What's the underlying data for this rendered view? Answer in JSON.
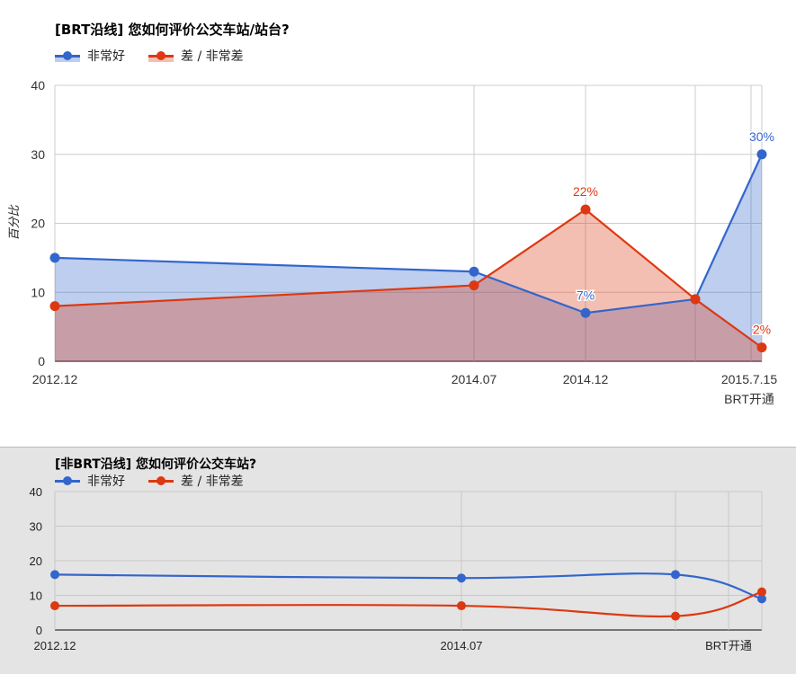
{
  "colors": {
    "good": "#3366cc",
    "bad": "#dc3912"
  },
  "chart_data": [
    {
      "type": "area",
      "title": "[BRT沿线] 您如何评价公交车站/站台?",
      "ylabel": "百分比",
      "ylim": [
        0,
        40
      ],
      "y_ticks": [
        "0",
        "10",
        "20",
        "30",
        "40"
      ],
      "x": [
        "2012-12",
        "2014-07",
        "2014-12",
        "2015-05",
        "2015-07-15"
      ],
      "x_tick_labels": [
        "2012.12",
        "2014.07",
        "2014.12",
        "",
        "2015.7.15"
      ],
      "x_event_label": "BRT开通",
      "grid": true,
      "legend": "top-left",
      "series": [
        {
          "name": "非常好",
          "values": [
            15,
            13,
            7,
            9,
            30
          ],
          "annotations": [
            "",
            "",
            "7%",
            "",
            "30%"
          ]
        },
        {
          "name": "差 / 非常差",
          "values": [
            8,
            11,
            22,
            9,
            2
          ],
          "annotations": [
            "",
            "",
            "22%",
            "",
            "2%"
          ]
        }
      ]
    },
    {
      "type": "line",
      "title": "[非BRT沿线] 您如何评价公交车站?",
      "ylim": [
        0,
        40
      ],
      "y_ticks": [
        "0",
        "10",
        "20",
        "30",
        "40"
      ],
      "x": [
        "2012-12",
        "2014-07",
        "2015-05",
        "2015-07-15"
      ],
      "x_tick_labels": [
        "2012.12",
        "2014.07",
        "BRT开通"
      ],
      "grid": true,
      "legend": "top-left",
      "series": [
        {
          "name": "非常好",
          "values": [
            16,
            15,
            16,
            9
          ]
        },
        {
          "name": "差 / 非常差",
          "values": [
            7,
            7,
            4,
            11
          ]
        }
      ]
    }
  ]
}
